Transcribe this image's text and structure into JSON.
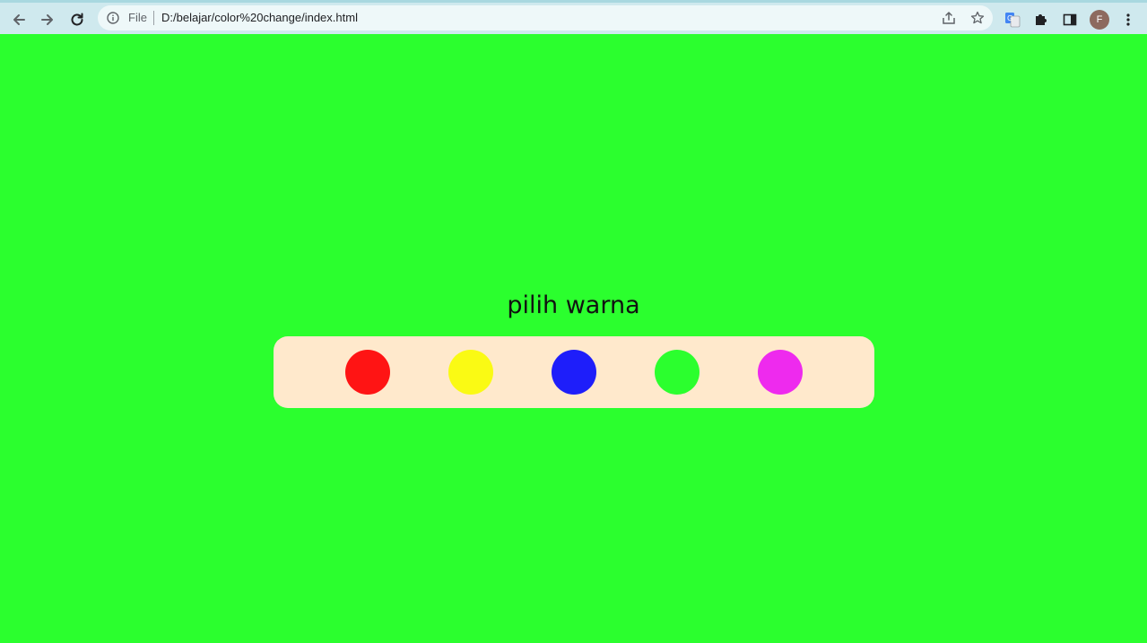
{
  "browser": {
    "file_label": "File",
    "url": "D:/belajar/color%20change/index.html",
    "profile_initial": "F"
  },
  "page": {
    "title": "pilih warna",
    "background_color": "#2bff2e",
    "panel_color": "#ffe9cc"
  },
  "swatches": [
    {
      "name": "red",
      "color": "#ff1414"
    },
    {
      "name": "yellow",
      "color": "#fafa14"
    },
    {
      "name": "blue",
      "color": "#1e1efa"
    },
    {
      "name": "green",
      "color": "#2bff2e"
    },
    {
      "name": "magenta",
      "color": "#ee2aee"
    }
  ]
}
